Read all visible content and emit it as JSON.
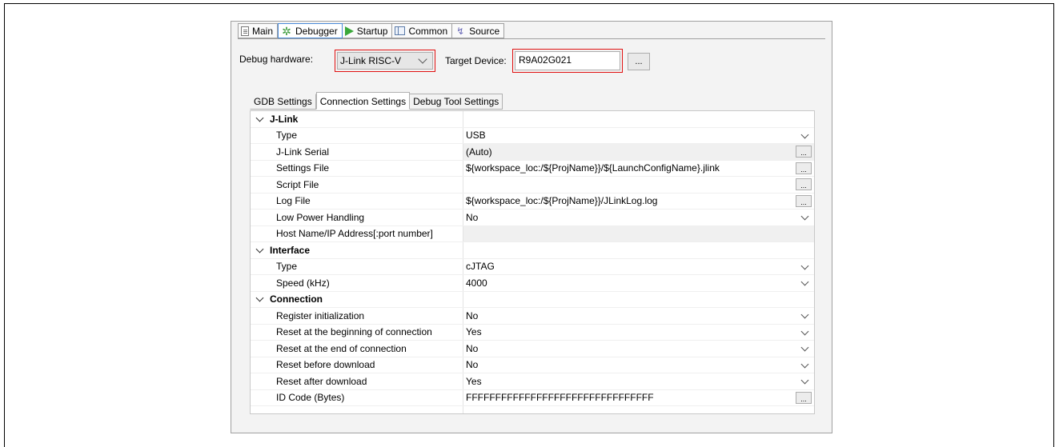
{
  "tabs": [
    {
      "label": "Main",
      "icon": "main-tab-icon"
    },
    {
      "label": "Debugger",
      "icon": "debugger-bug-icon",
      "active": true
    },
    {
      "label": "Startup",
      "icon": "play-icon"
    },
    {
      "label": "Common",
      "icon": "common-table-icon"
    },
    {
      "label": "Source",
      "icon": "source-icon"
    }
  ],
  "debug_hardware": {
    "label": "Debug hardware:",
    "value": "J-Link RISC-V"
  },
  "target_device": {
    "label": "Target Device:",
    "value": "R9A02G021",
    "browse_label": "..."
  },
  "inner_tabs": [
    {
      "label": "GDB Settings"
    },
    {
      "label": "Connection Settings",
      "active": true
    },
    {
      "label": "Debug Tool Settings"
    }
  ],
  "properties": {
    "jlink": {
      "title": "J-Link",
      "rows": [
        {
          "key": "Type",
          "value": "USB",
          "control": "dropdown"
        },
        {
          "key": "J-Link Serial",
          "value": "(Auto)",
          "control": "button"
        },
        {
          "key": "Settings File",
          "value": "${workspace_loc:/${ProjName}}/${LaunchConfigName}.jlink",
          "control": "button"
        },
        {
          "key": "Script File",
          "value": "",
          "control": "button"
        },
        {
          "key": "Log File",
          "value": "${workspace_loc:/${ProjName}}/JLinkLog.log",
          "control": "button"
        },
        {
          "key": "Low Power Handling",
          "value": "No",
          "control": "dropdown"
        },
        {
          "key": "Host Name/IP Address[:port number]",
          "value": "",
          "control": "none"
        }
      ]
    },
    "interface": {
      "title": "Interface",
      "rows": [
        {
          "key": "Type",
          "value": "cJTAG",
          "control": "dropdown"
        },
        {
          "key": "Speed (kHz)",
          "value": "4000",
          "control": "dropdown"
        }
      ]
    },
    "connection": {
      "title": "Connection",
      "rows": [
        {
          "key": "Register initialization",
          "value": "No",
          "control": "dropdown"
        },
        {
          "key": "Reset at the beginning of connection",
          "value": "Yes",
          "control": "dropdown"
        },
        {
          "key": "Reset at the end of connection",
          "value": "No",
          "control": "dropdown"
        },
        {
          "key": "Reset before download",
          "value": "No",
          "control": "dropdown"
        },
        {
          "key": "Reset after download",
          "value": "Yes",
          "control": "dropdown"
        },
        {
          "key": "ID Code (Bytes)",
          "value": "FFFFFFFFFFFFFFFFFFFFFFFFFFFFFFFF",
          "control": "button"
        }
      ]
    }
  },
  "row_button_label": "...",
  "colors": {
    "highlight_box": "#e01010",
    "active_tab_border": "#4a8ad8"
  }
}
